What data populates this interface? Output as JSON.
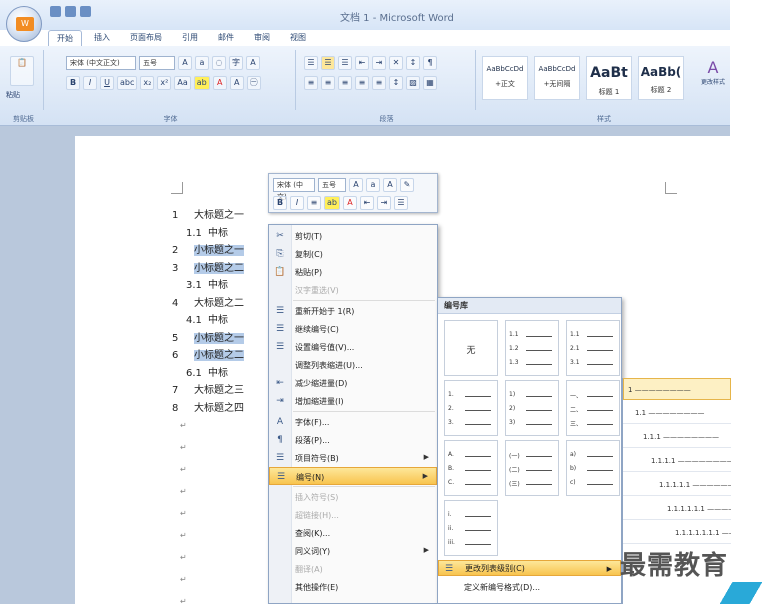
{
  "window": {
    "title": "文档 1 - Microsoft Word"
  },
  "tabs": [
    "开始",
    "插入",
    "页面布局",
    "引用",
    "邮件",
    "审阅",
    "视图"
  ],
  "ribbon": {
    "clipboard_label": "剪贴板",
    "paste_label": "粘贴",
    "font_label": "字体",
    "paragraph_label": "段落",
    "styles_label": "样式",
    "font_name": "宋体 (中文正文)",
    "font_size": "五号",
    "styles": [
      {
        "sample": "AaBbCcDd",
        "name": "+正文"
      },
      {
        "sample": "AaBbCcDd",
        "name": "+无间隔"
      },
      {
        "sample": "AaBt",
        "name": "标题 1"
      },
      {
        "sample": "AaBb(",
        "name": "标题 2"
      }
    ],
    "change_styles": "更改样式"
  },
  "document": {
    "lines": [
      {
        "num": "1",
        "text": "大标题之一",
        "selected": false
      },
      {
        "num": "1.1",
        "text": "中标",
        "selected": false
      },
      {
        "num": "2",
        "text": "小标题之一",
        "selected": true
      },
      {
        "num": "3",
        "text": "小标题之二",
        "selected": true
      },
      {
        "num": "3.1",
        "text": "中标",
        "selected": false
      },
      {
        "num": "4",
        "text": "大标题之二",
        "selected": false
      },
      {
        "num": "4.1",
        "text": "中标",
        "selected": false
      },
      {
        "num": "5",
        "text": "小标题之一",
        "selected": true
      },
      {
        "num": "6",
        "text": "小标题之二",
        "selected": true
      },
      {
        "num": "6.1",
        "text": "中标",
        "selected": false
      },
      {
        "num": "7",
        "text": "大标题之三",
        "selected": false
      },
      {
        "num": "8",
        "text": "大标题之四",
        "selected": false
      }
    ]
  },
  "minibar": {
    "font_name": "宋体 (中文)",
    "font_size": "五号"
  },
  "context_menu": {
    "items": [
      {
        "icon": "✂",
        "label": "剪切(T)",
        "disabled": false
      },
      {
        "icon": "⎘",
        "label": "复制(C)",
        "disabled": false
      },
      {
        "icon": "📋",
        "label": "粘贴(P)",
        "disabled": false
      },
      {
        "icon": "",
        "label": "汉字重选(V)",
        "disabled": true
      },
      {
        "icon": "☰",
        "label": "重新开始于 1(R)",
        "disabled": false
      },
      {
        "icon": "☰",
        "label": "继续编号(C)",
        "disabled": false
      },
      {
        "icon": "☰",
        "label": "设置编号值(V)...",
        "disabled": false
      },
      {
        "icon": "",
        "label": "调整列表缩进(U)...",
        "disabled": false
      },
      {
        "icon": "⇤",
        "label": "减少缩进量(D)",
        "disabled": false
      },
      {
        "icon": "⇥",
        "label": "增加缩进量(I)",
        "disabled": false
      },
      {
        "icon": "A",
        "label": "字体(F)...",
        "disabled": false
      },
      {
        "icon": "¶",
        "label": "段落(P)...",
        "disabled": false
      },
      {
        "icon": "☰",
        "label": "项目符号(B)",
        "disabled": false,
        "submenu": true
      },
      {
        "icon": "☰",
        "label": "编号(N)",
        "disabled": false,
        "submenu": true,
        "highlighted": true
      },
      {
        "icon": "",
        "label": "插入符号(S)",
        "disabled": true
      },
      {
        "icon": "",
        "label": "超链接(H)...",
        "disabled": true
      },
      {
        "icon": "",
        "label": "查阅(K)...",
        "disabled": false
      },
      {
        "icon": "",
        "label": "同义词(Y)",
        "disabled": false,
        "submenu": true
      },
      {
        "icon": "",
        "label": "翻译(A)",
        "disabled": true
      },
      {
        "icon": "",
        "label": "其他操作(E)",
        "disabled": false
      }
    ]
  },
  "numbering_submenu": {
    "title": "编号库",
    "none_label": "无",
    "cells": [
      {
        "kind": "none"
      },
      {
        "kind": "list",
        "labels": [
          "1.1",
          "1.2",
          "1.3"
        ]
      },
      {
        "kind": "list",
        "labels": [
          "1.1",
          "2.1",
          "3.1"
        ]
      },
      {
        "kind": "list",
        "labels": [
          "1.",
          "2.",
          "3."
        ]
      },
      {
        "kind": "list",
        "labels": [
          "1)",
          "2)",
          "3)"
        ]
      },
      {
        "kind": "list",
        "labels": [
          "一、",
          "二、",
          "三、"
        ]
      },
      {
        "kind": "list",
        "labels": [
          "A.",
          "B.",
          "C."
        ]
      },
      {
        "kind": "list",
        "labels": [
          "(一)",
          "(二)",
          "(三)"
        ]
      },
      {
        "kind": "list",
        "labels": [
          "a)",
          "b)",
          "c)"
        ]
      },
      {
        "kind": "list",
        "labels": [
          "i.",
          "ii.",
          "iii."
        ]
      }
    ],
    "change_level": "更改列表级别(C)",
    "define_new": "定义新编号格式(D)..."
  },
  "level_panel": {
    "levels": [
      "1",
      "1.1",
      "1.1.1",
      "1.1.1.1",
      "1.1.1.1.1",
      "1.1.1.1.1.1",
      "1.1.1.1.1.1.1"
    ]
  },
  "watermark": {
    "text": "最需教育"
  }
}
